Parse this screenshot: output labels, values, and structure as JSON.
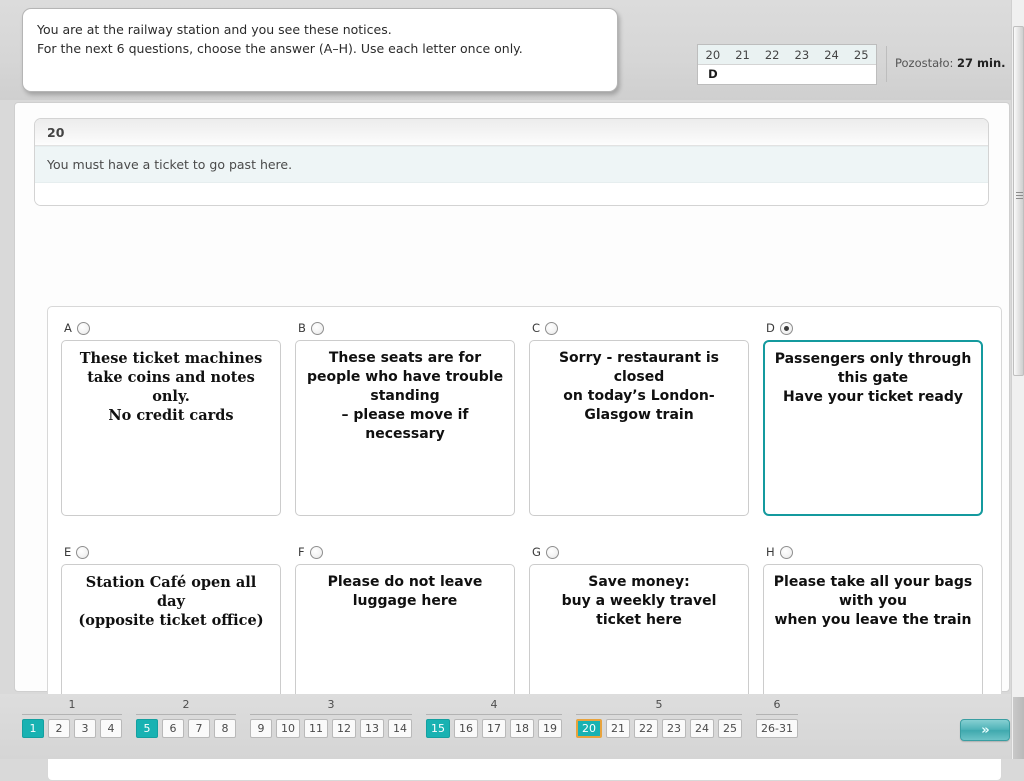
{
  "instructions": {
    "line1": "You are at the railway station and you see these notices.",
    "line2": "For the next 6 questions, choose the answer (A–H). Use each letter once only."
  },
  "answer_grid": {
    "question_numbers": [
      "20",
      "21",
      "22",
      "23",
      "24",
      "25"
    ],
    "answers": [
      "D",
      "",
      "",
      "",
      "",
      ""
    ]
  },
  "timer": {
    "label": "Pozostało:",
    "value": "27 min."
  },
  "question": {
    "number": "20",
    "prompt": "You must have a ticket to go past here."
  },
  "options": [
    {
      "letter": "A",
      "selected": false,
      "font": "serif",
      "lines": [
        "These ticket machines take coins and notes only.",
        "No credit cards"
      ],
      "text": "These ticket machines take coins and notes only.\nNo credit cards"
    },
    {
      "letter": "B",
      "selected": false,
      "font": "sans",
      "lines": [
        "These seats are for people who have trouble standing",
        "– please move if necessary"
      ],
      "text": "These seats are for people who have trouble standing\n\n– please move if necessary"
    },
    {
      "letter": "C",
      "selected": false,
      "font": "sans",
      "lines": [
        "Sorry - restaurant is closed",
        "on today’s London-Glasgow train"
      ],
      "text": "Sorry - restaurant is closed\non today’s London-Glasgow train"
    },
    {
      "letter": "D",
      "selected": true,
      "font": "sans",
      "lines": [
        "Passengers only through this gate",
        "Have your ticket ready"
      ],
      "text": "Passengers only through this gate\nHave your ticket ready"
    },
    {
      "letter": "E",
      "selected": false,
      "font": "serif",
      "lines": [
        "Station Café open all day",
        "(opposite ticket office)"
      ],
      "text": "Station Café open all day\n(opposite ticket office)"
    },
    {
      "letter": "F",
      "selected": false,
      "font": "sans",
      "lines": [
        "Please do not leave luggage here"
      ],
      "text": "Please do not leave luggage here"
    },
    {
      "letter": "G",
      "selected": false,
      "font": "sans",
      "lines": [
        "Save money:",
        "buy a weekly travel ticket here"
      ],
      "text": "Save money:\nbuy a weekly travel ticket here"
    },
    {
      "letter": "H",
      "selected": false,
      "font": "sans",
      "lines": [
        "Please take all your bags with you",
        "when you leave the train"
      ],
      "text": "Please take all your bags with you when you leave the train"
    }
  ],
  "pager": {
    "groups": [
      {
        "label": "1",
        "items": [
          {
            "text": "1",
            "state": "section"
          },
          {
            "text": "2",
            "state": "normal"
          },
          {
            "text": "3",
            "state": "normal"
          },
          {
            "text": "4",
            "state": "normal"
          }
        ]
      },
      {
        "label": "2",
        "items": [
          {
            "text": "5",
            "state": "section"
          },
          {
            "text": "6",
            "state": "normal"
          },
          {
            "text": "7",
            "state": "normal"
          },
          {
            "text": "8",
            "state": "normal"
          }
        ]
      },
      {
        "label": "3",
        "items": [
          {
            "text": "9",
            "state": "normal"
          },
          {
            "text": "10",
            "state": "normal"
          },
          {
            "text": "11",
            "state": "normal"
          },
          {
            "text": "12",
            "state": "normal"
          },
          {
            "text": "13",
            "state": "normal"
          },
          {
            "text": "14",
            "state": "normal"
          }
        ]
      },
      {
        "label": "4",
        "items": [
          {
            "text": "15",
            "state": "section"
          },
          {
            "text": "16",
            "state": "normal"
          },
          {
            "text": "17",
            "state": "normal"
          },
          {
            "text": "18",
            "state": "normal"
          },
          {
            "text": "19",
            "state": "normal"
          }
        ]
      },
      {
        "label": "5",
        "items": [
          {
            "text": "20",
            "state": "current"
          },
          {
            "text": "21",
            "state": "normal"
          },
          {
            "text": "22",
            "state": "normal"
          },
          {
            "text": "23",
            "state": "normal"
          },
          {
            "text": "24",
            "state": "normal"
          },
          {
            "text": "25",
            "state": "normal"
          }
        ]
      },
      {
        "label": "6",
        "items": [
          {
            "text": "26-31",
            "state": "normal"
          }
        ]
      }
    ]
  },
  "next_button": {
    "icon": "double-chevron-right-icon",
    "glyph": "»"
  },
  "colors": {
    "accent_teal": "#18b2b2",
    "selected_border": "#149a9e",
    "current_outline": "#e8a33d",
    "question_band": "#eef5f6"
  }
}
